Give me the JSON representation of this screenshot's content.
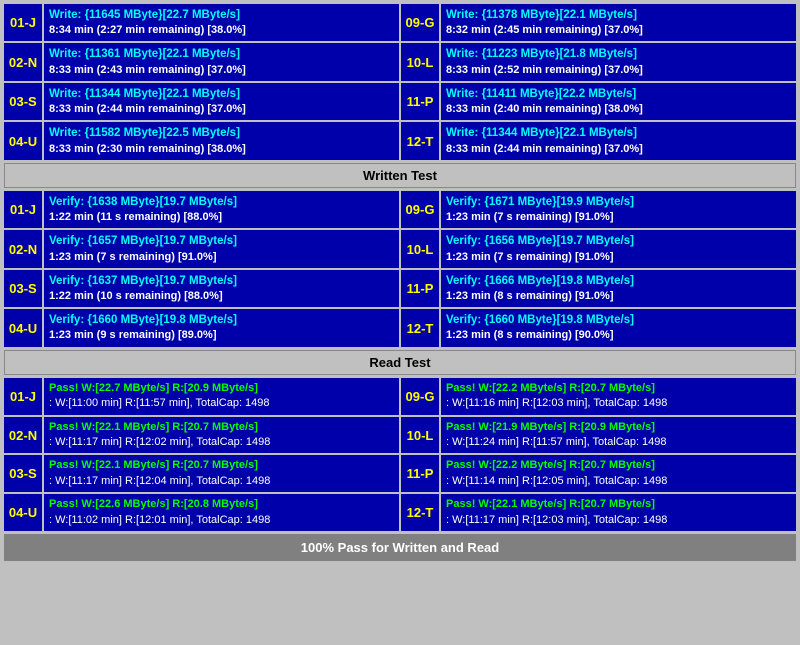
{
  "sections": {
    "write": {
      "rows": [
        {
          "left_label": "01-J",
          "left_line1": "Write: {11645 MByte}[22.7 MByte/s]",
          "left_line2": "8:34 min (2:27 min remaining)  [38.0%]",
          "right_label": "09-G",
          "right_line1": "Write: {11378 MByte}[22.1 MByte/s]",
          "right_line2": "8:32 min (2:45 min remaining)  [37.0%]"
        },
        {
          "left_label": "02-N",
          "left_line1": "Write: {11361 MByte}[22.1 MByte/s]",
          "left_line2": "8:33 min (2:43 min remaining)  [37.0%]",
          "right_label": "10-L",
          "right_line1": "Write: {11223 MByte}[21.8 MByte/s]",
          "right_line2": "8:33 min (2:52 min remaining)  [37.0%]"
        },
        {
          "left_label": "03-S",
          "left_line1": "Write: {11344 MByte}[22.1 MByte/s]",
          "left_line2": "8:33 min (2:44 min remaining)  [37.0%]",
          "right_label": "11-P",
          "right_line1": "Write: {11411 MByte}[22.2 MByte/s]",
          "right_line2": "8:33 min (2:40 min remaining)  [38.0%]"
        },
        {
          "left_label": "04-U",
          "left_line1": "Write: {11582 MByte}[22.5 MByte/s]",
          "left_line2": "8:33 min (2:30 min remaining)  [38.0%]",
          "right_label": "12-T",
          "right_line1": "Write: {11344 MByte}[22.1 MByte/s]",
          "right_line2": "8:33 min (2:44 min remaining)  [37.0%]"
        }
      ],
      "divider": "Written Test"
    },
    "verify": {
      "rows": [
        {
          "left_label": "01-J",
          "left_line1": "Verify: {1638 MByte}[19.7 MByte/s]",
          "left_line2": "1:22 min (11 s remaining)  [88.0%]",
          "right_label": "09-G",
          "right_line1": "Verify: {1671 MByte}[19.9 MByte/s]",
          "right_line2": "1:23 min (7 s remaining)  [91.0%]"
        },
        {
          "left_label": "02-N",
          "left_line1": "Verify: {1657 MByte}[19.7 MByte/s]",
          "left_line2": "1:23 min (7 s remaining)  [91.0%]",
          "right_label": "10-L",
          "right_line1": "Verify: {1656 MByte}[19.7 MByte/s]",
          "right_line2": "1:23 min (7 s remaining)  [91.0%]"
        },
        {
          "left_label": "03-S",
          "left_line1": "Verify: {1637 MByte}[19.7 MByte/s]",
          "left_line2": "1:22 min (10 s remaining)  [88.0%]",
          "right_label": "11-P",
          "right_line1": "Verify: {1666 MByte}[19.8 MByte/s]",
          "right_line2": "1:23 min (8 s remaining)  [91.0%]"
        },
        {
          "left_label": "04-U",
          "left_line1": "Verify: {1660 MByte}[19.8 MByte/s]",
          "left_line2": "1:23 min (9 s remaining)  [89.0%]",
          "right_label": "12-T",
          "right_line1": "Verify: {1660 MByte}[19.8 MByte/s]",
          "right_line2": "1:23 min (8 s remaining)  [90.0%]"
        }
      ],
      "divider": "Read Test"
    },
    "pass": {
      "rows": [
        {
          "left_label": "01-J",
          "left_line1": "Pass! W:[22.7 MByte/s] R:[20.9 MByte/s]",
          "left_line2": ": W:[11:00 min] R:[11:57 min], TotalCap: 1498",
          "right_label": "09-G",
          "right_line1": "Pass! W:[22.2 MByte/s] R:[20.7 MByte/s]",
          "right_line2": ": W:[11:16 min] R:[12:03 min], TotalCap: 1498"
        },
        {
          "left_label": "02-N",
          "left_line1": "Pass! W:[22.1 MByte/s] R:[20.7 MByte/s]",
          "left_line2": ": W:[11:17 min] R:[12:02 min], TotalCap: 1498",
          "right_label": "10-L",
          "right_line1": "Pass! W:[21.9 MByte/s] R:[20.9 MByte/s]",
          "right_line2": ": W:[11:24 min] R:[11:57 min], TotalCap: 1498"
        },
        {
          "left_label": "03-S",
          "left_line1": "Pass! W:[22.1 MByte/s] R:[20.7 MByte/s]",
          "left_line2": ": W:[11:17 min] R:[12:04 min], TotalCap: 1498",
          "right_label": "11-P",
          "right_line1": "Pass! W:[22.2 MByte/s] R:[20.7 MByte/s]",
          "right_line2": ": W:[11:14 min] R:[12:05 min], TotalCap: 1498"
        },
        {
          "left_label": "04-U",
          "left_line1": "Pass! W:[22.6 MByte/s] R:[20.8 MByte/s]",
          "left_line2": ": W:[11:02 min] R:[12:01 min], TotalCap: 1498",
          "right_label": "12-T",
          "right_line1": "Pass! W:[22.1 MByte/s] R:[20.7 MByte/s]",
          "right_line2": ": W:[11:17 min] R:[12:03 min], TotalCap: 1498"
        }
      ],
      "bottom": "100% Pass for Written and Read"
    }
  }
}
